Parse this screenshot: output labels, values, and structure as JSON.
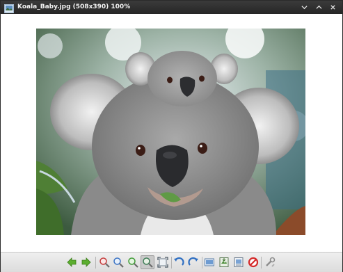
{
  "window": {
    "title": "Koala_Baby.jpg (508x390) 100%",
    "controls": [
      "chevron-down",
      "chevron-up",
      "close"
    ]
  },
  "image": {
    "subject": "koala with baby koala on head",
    "accent_colors": {
      "fur": "#8f8f8f",
      "foliage": "#4f7f35",
      "nose": "#2a2b2e",
      "sky": "#3c6f87"
    }
  },
  "toolbar": {
    "buttons": [
      "previous-image",
      "next-image",
      "zoom-in",
      "zoom-out",
      "zoom-100",
      "fit-to-window",
      "fullscreen",
      "rotate-left",
      "rotate-right",
      "open-file",
      "save-image",
      "properties",
      "delete",
      "settings"
    ],
    "active": "fit-to-window"
  }
}
